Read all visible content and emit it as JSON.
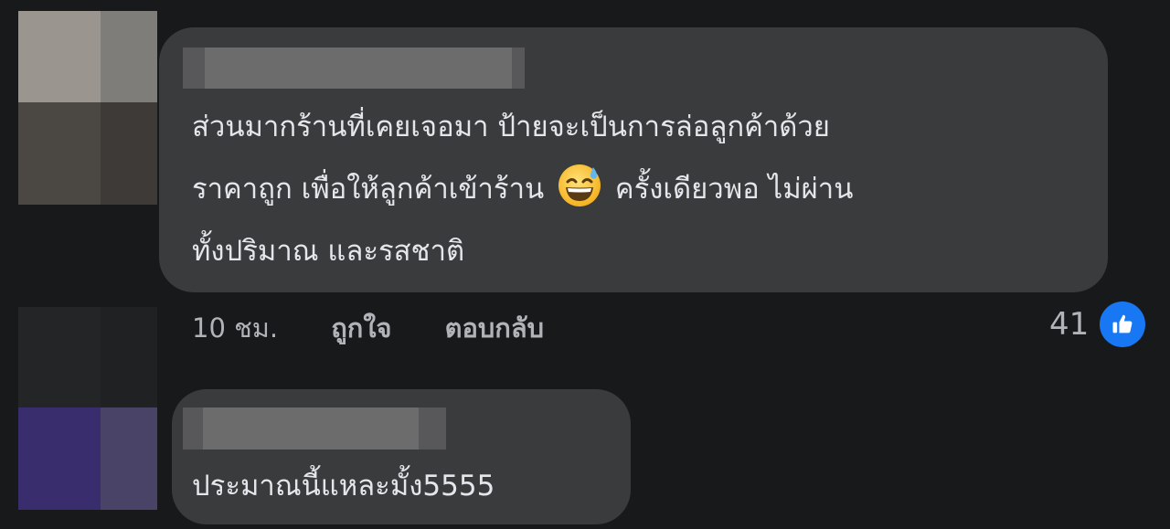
{
  "comments": [
    {
      "text_lines": [
        "ส่วนมากร้านที่เคยเจอมา ป้ายจะเป็นการล่อลูกค้าด้วย",
        "ราคาถูก เพื่อให้ลูกค้าเข้าร้าน",
        "ครั้งเดียวพอ ไม่ผ่าน",
        "ทั้งปริมาณ และรสชาติ"
      ],
      "emoji": "grinning-face-with-sweat",
      "time": "10 ชม.",
      "like_label": "ถูกใจ",
      "reply_label": "ตอบกลับ",
      "reaction_count": "41",
      "reaction_icon": "thumbs-up-icon",
      "reaction_color": "#1877f2"
    },
    {
      "text": "ประมาณนี้แหละมั้ง5555"
    }
  ]
}
